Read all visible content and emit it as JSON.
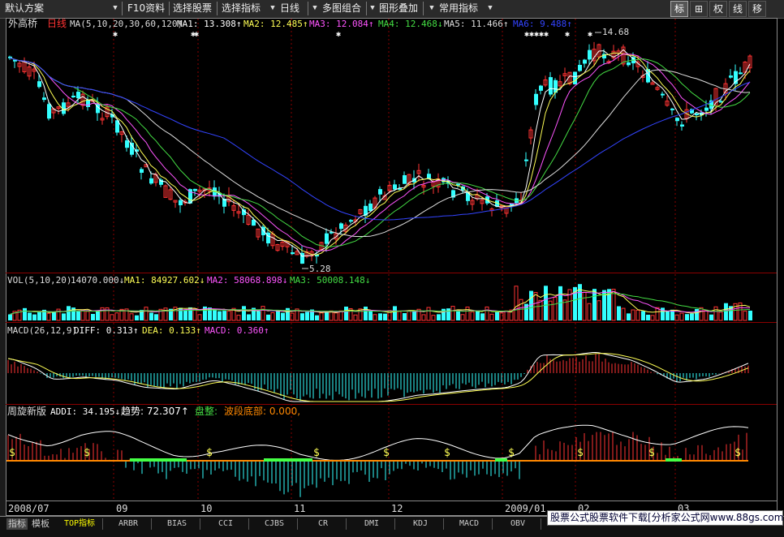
{
  "toolbar": {
    "scheme": "默认方案",
    "f10": "F10资料",
    "select_stock": "选择股票",
    "select_indicator": "选择指标",
    "period": "日线",
    "multi_chart": "多图组合",
    "overlay": "图形叠加",
    "common_indicator": "常用指标",
    "right_buttons": [
      "标",
      "⊞",
      "权",
      "线",
      "移"
    ]
  },
  "main": {
    "stock_name": "外高桥",
    "period": "日线",
    "ma_label": "MA(5,10,20,30,60,120)",
    "ma": [
      {
        "text": "MA1: 13.308↑",
        "color": "#ffffff"
      },
      {
        "text": "MA2: 12.485↑",
        "color": "#ffff55"
      },
      {
        "text": "MA3: 12.084↑",
        "color": "#ff55ff"
      },
      {
        "text": "MA4: 12.468↓",
        "color": "#44dd44"
      },
      {
        "text": "MA5: 11.466↑",
        "color": "#dddddd"
      },
      {
        "text": "MA6: 9.488↑",
        "color": "#3344ff"
      }
    ],
    "high_label": "14.68",
    "low_label": "5.28"
  },
  "volume": {
    "label": "VOL(5,10,20)",
    "value": "14070.000↓",
    "ma": [
      {
        "text": "MA1: 84927.602↓",
        "color": "#ffff55"
      },
      {
        "text": "MA2: 58068.898↓",
        "color": "#ff55ff"
      },
      {
        "text": "MA3: 50008.148↓",
        "color": "#44dd44"
      }
    ]
  },
  "macd": {
    "label": "MACD(26,12,9)",
    "diff": "DIFF: 0.313↑",
    "dea": "DEA: 0.133↑",
    "macd": "MACD: 0.360↑"
  },
  "zhouxuan": {
    "label": "周旋新版",
    "addi": "ADDI: 34.195↓",
    "trend": "趋势: 72.307↑",
    "consolidation": "盘整:",
    "bottom": "波段底部: 0.000,"
  },
  "dates": [
    "2008/07",
    "09",
    "10",
    "11",
    "12",
    "2009/01",
    "02",
    "03"
  ],
  "bottom_tabs": [
    "TOP指标",
    "ARBR",
    "BIAS",
    "CCI",
    "CJBS",
    "CR",
    "DMI",
    "KDJ",
    "MACD",
    "OBV"
  ],
  "left_tabs": [
    "指标",
    "模板"
  ],
  "promo": "股票公式股票软件下载[分析家公式网www.88gs.com]",
  "colors": {
    "up": "#ff3333",
    "down": "#33ffff",
    "white": "#ffffff"
  }
}
